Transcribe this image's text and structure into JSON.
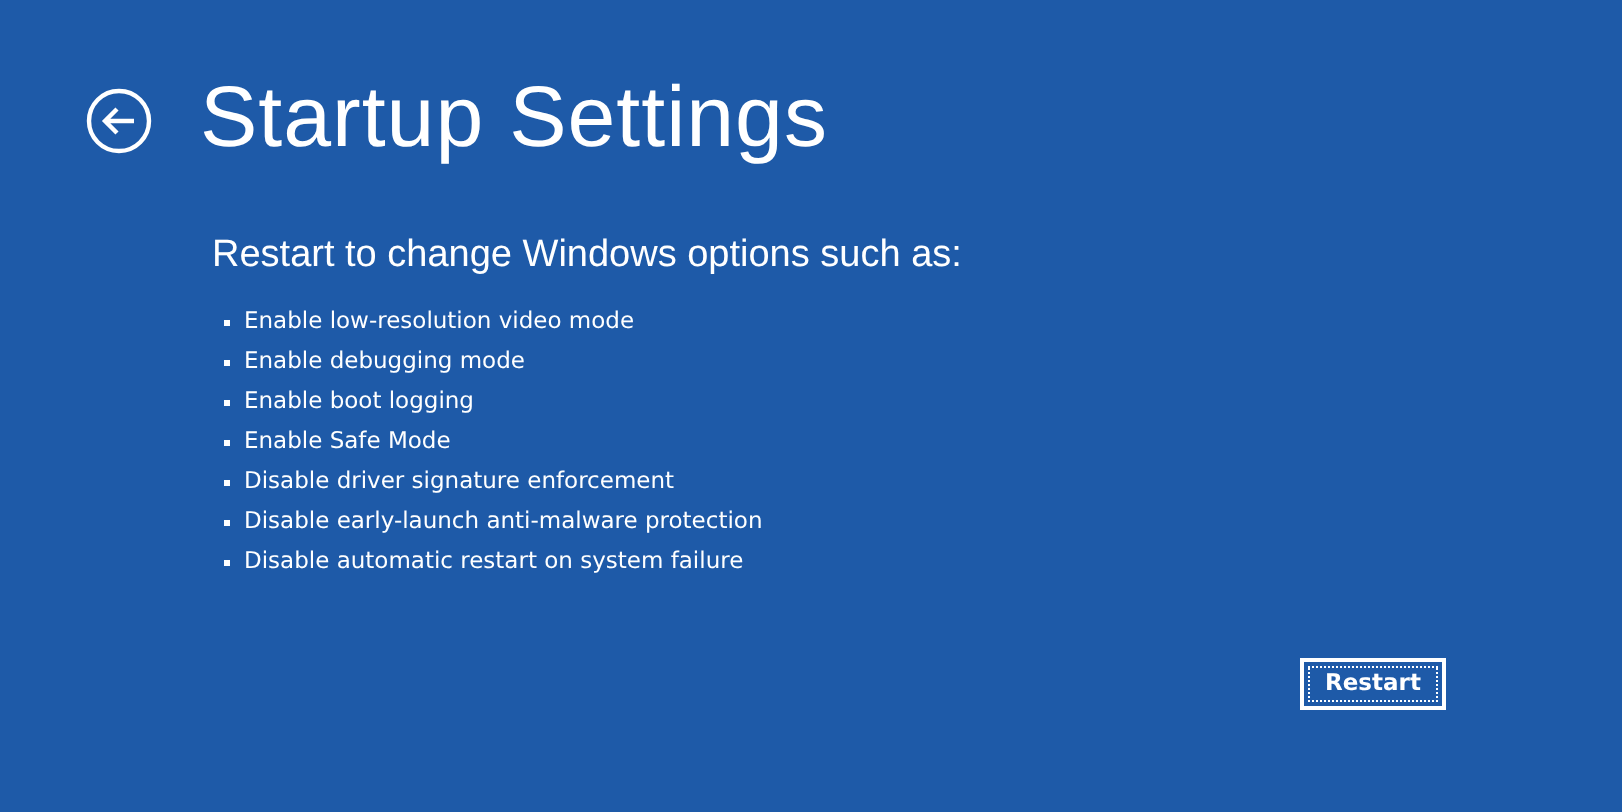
{
  "title": "Startup Settings",
  "subtitle": "Restart to change Windows options such as:",
  "options": [
    "Enable low-resolution video mode",
    "Enable debugging mode",
    "Enable boot logging",
    "Enable Safe Mode",
    "Disable driver signature enforcement",
    "Disable early-launch anti-malware protection",
    "Disable automatic restart on system failure"
  ],
  "button": {
    "label": "Restart",
    "focused": true
  }
}
